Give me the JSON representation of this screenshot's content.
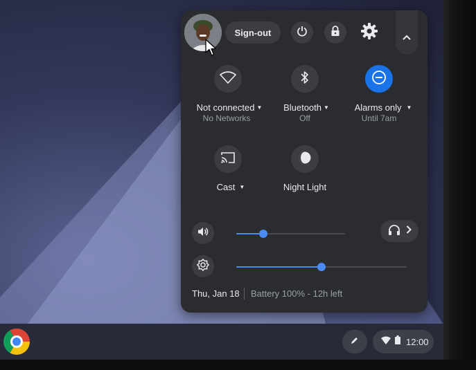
{
  "system_menu": {
    "sign_out_label": "Sign-out",
    "network": {
      "label": "Not connected",
      "sub": "No Networks"
    },
    "bluetooth": {
      "label": "Bluetooth",
      "sub": "Off"
    },
    "dnd": {
      "label": "Alarms only",
      "sub": "Until 7am"
    },
    "cast": {
      "label": "Cast"
    },
    "night_light": {
      "label": "Night Light"
    },
    "volume_level": 0.25,
    "brightness_level": 0.5,
    "date": "Thu, Jan 18",
    "battery": "Battery 100% - 12h left"
  },
  "shelf": {
    "time": "12:00"
  },
  "colors": {
    "accent": "#1a73e8",
    "slider": "#4c8bf5",
    "panel": "#2b2c30",
    "button": "#3c3d42"
  },
  "icons": [
    "chrome-icon",
    "stylus-icon",
    "wifi-icon",
    "battery-icon",
    "power-icon",
    "lock-icon",
    "gear-icon",
    "chevron-up-icon",
    "wifi-icon",
    "bluetooth-icon",
    "do-not-disturb-icon",
    "cast-icon",
    "night-light-icon",
    "volume-icon",
    "headphones-icon",
    "chevron-right-icon",
    "brightness-icon"
  ]
}
